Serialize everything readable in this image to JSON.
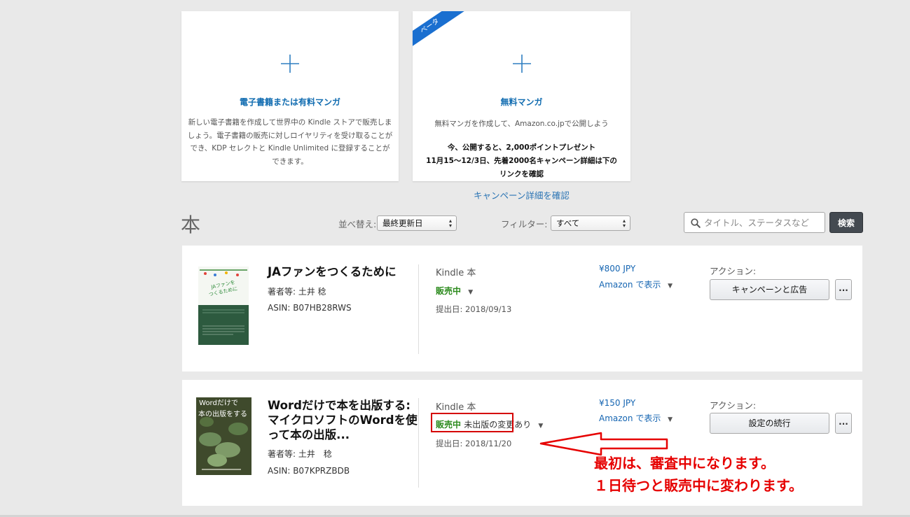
{
  "cards": [
    {
      "title": "電子書籍または有料マンガ",
      "description": "新しい電子書籍を作成して世界中の Kindle ストアで販売しましょう。電子書籍の販売に対しロイヤリティを受け取ることができ、KDP セレクトと Kindle Unlimited に登録することができます。"
    },
    {
      "badge": "ベータ",
      "title": "無料マンガ",
      "description": "無料マンガを作成して、Amazon.co.jpで公開しよう",
      "promo_line1": "今、公開すると、2,000ポイントプレゼント",
      "promo_line2": "11月15～12/3日、先着2000名キャンペーン詳細は下のリンクを確認"
    }
  ],
  "campaign_link": "キャンペーン詳細を確認",
  "section": {
    "title": "本",
    "sort_label": "並べ替え:",
    "sort_value": "最終更新日",
    "filter_label": "フィルター:",
    "filter_value": "すべて",
    "search_placeholder": "タイトル、ステータスなど",
    "search_button": "検索"
  },
  "books": [
    {
      "title": "JAファンをつくるために",
      "author": "著者等: 土井 稔",
      "asin": "ASIN: B07HB28RWS",
      "format": "Kindle 本",
      "status": "販売中",
      "status_sub": "",
      "submitted": "提出日: 2018/09/13",
      "price": "¥800 JPY",
      "amazon_link": "Amazon で表示",
      "action_label": "アクション:",
      "action_button": "キャンペーンと広告",
      "more": "...",
      "cover_title": "JAファンをつくるために"
    },
    {
      "title": "Wordだけで本を出版する: マイクロソフトのWordを使って本の出版...",
      "author": "著者等: 土井　稔",
      "asin": "ASIN: B07KPRZBDB",
      "format": "Kindle 本",
      "status": "販売中",
      "status_sub": "未出版の変更あり",
      "submitted": "提出日: 2018/11/20",
      "price": "¥150 JPY",
      "amazon_link": "Amazon で表示",
      "action_label": "アクション:",
      "action_button": "設定の続行",
      "more": "...",
      "cover_title": "Wordだけで本の出版をする"
    }
  ],
  "annotation": {
    "line1": "最初は、審査中になります。",
    "line2": "１日待つと販売中に変わります。"
  },
  "colors": {
    "link": "#1565b2",
    "status_green": "#2b8a1c",
    "annotation_red": "#e60000",
    "beta_badge": "#1a6fd0"
  }
}
